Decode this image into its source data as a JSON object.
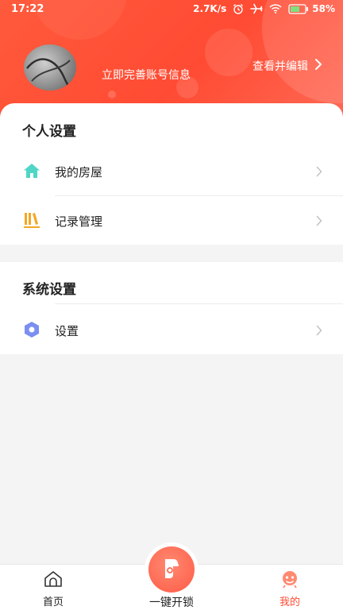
{
  "status_bar": {
    "time": "17:22",
    "net_speed": "2.7K/s",
    "battery": "58%"
  },
  "profile": {
    "complete_info": "立即完善账号信息",
    "edit_link": "查看并编辑"
  },
  "personal_settings": {
    "title": "个人设置",
    "items": [
      {
        "label": "我的房屋",
        "icon": "house-icon"
      },
      {
        "label": "记录管理",
        "icon": "records-icon"
      }
    ]
  },
  "system_settings": {
    "title": "系统设置",
    "items": [
      {
        "label": "设置",
        "icon": "hexagon-settings-icon"
      }
    ]
  },
  "tabbar": {
    "home": "首页",
    "unlock": "一键开锁",
    "mine": "我的",
    "active": "mine"
  },
  "colors": {
    "accent": "#ff4b33",
    "house_icon": "#4fd6c6",
    "records_icon": "#f5a623",
    "settings_icon": "#7a8ff0"
  }
}
